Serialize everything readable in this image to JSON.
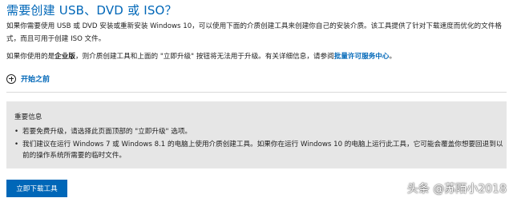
{
  "page_title": "需要创建 USB、DVD 或 ISO？",
  "intro_text": "如果你需要使用 USB 或 DVD 安装或重新安装 Windows 10，可以使用下面的介质创建工具来创建你自己的安装介质。该工具提供了针对下载速度而优化的文件格式，而且可用于创建 ISO 文件。",
  "enterprise_note": {
    "prefix": "如果你使用的是",
    "edition": "企业版",
    "middle": "，则介质创建工具和上面的 \"立即升级\" 按钮将无法用于升级。有关详细信息，请参阅",
    "link_text": "批量许可服务中心",
    "suffix": "。"
  },
  "expander": {
    "icon": "plus-circle-icon",
    "label": "开始之前"
  },
  "important_info": {
    "title": "重要信息",
    "items": [
      "若要免费升级，请选择此页面顶部的 \"立即升级\" 选项。",
      "我们建议在运行 Windows 7 或 Windows 8.1 的电脑上使用介质创建工具。如果你在运行 Windows 10 的电脑上运行此工具，它可能会覆盖你想要回退到以前的操作系统所需要的临时文件。"
    ]
  },
  "download_button": {
    "label": "立即下载工具"
  },
  "watermark": "头条 @苏陌小2018",
  "colors": {
    "accent": "#0067b8",
    "notice_background": "#e6e6e6"
  }
}
